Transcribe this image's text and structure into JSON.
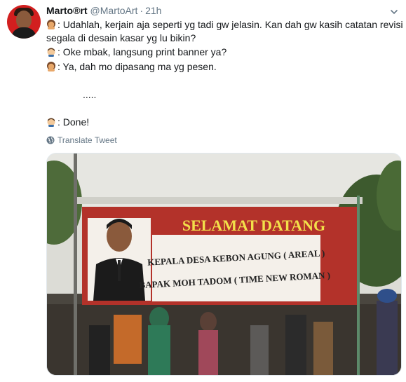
{
  "tweet": {
    "display_name": "Marto®rt",
    "handle": "@MartoArt",
    "separator": "·",
    "time": "21h",
    "lines": [
      ": Udahlah, kerjain aja seperti yg tadi gw jelasin. Kan dah gw kasih catatan revisi",
      "segala di desain kasar yg lu bikin?",
      ": Oke mbak, langsung print banner ya?",
      ": Ya, dah mo dipasang ma yg pesen.",
      ".....",
      ": Done!"
    ],
    "translate_label": "Translate Tweet"
  },
  "banner": {
    "headline": "SELAMAT DATANG",
    "line1": "KEPALA DESA KEBON AGUNG ( AREAL )",
    "line2": "BAPAK MOH TADOM ( TIME NEW ROMAN )"
  },
  "icons": {
    "avatar": "avatar-image",
    "caret": "chevron-down-icon",
    "woman_emoji": "woman-emoji-icon",
    "man_emoji": "man-emoji-icon",
    "globe": "globe-icon"
  },
  "colors": {
    "text": "#14171a",
    "muted": "#657786",
    "banner_red": "#b3322a",
    "banner_yellow": "#f2e04a"
  }
}
